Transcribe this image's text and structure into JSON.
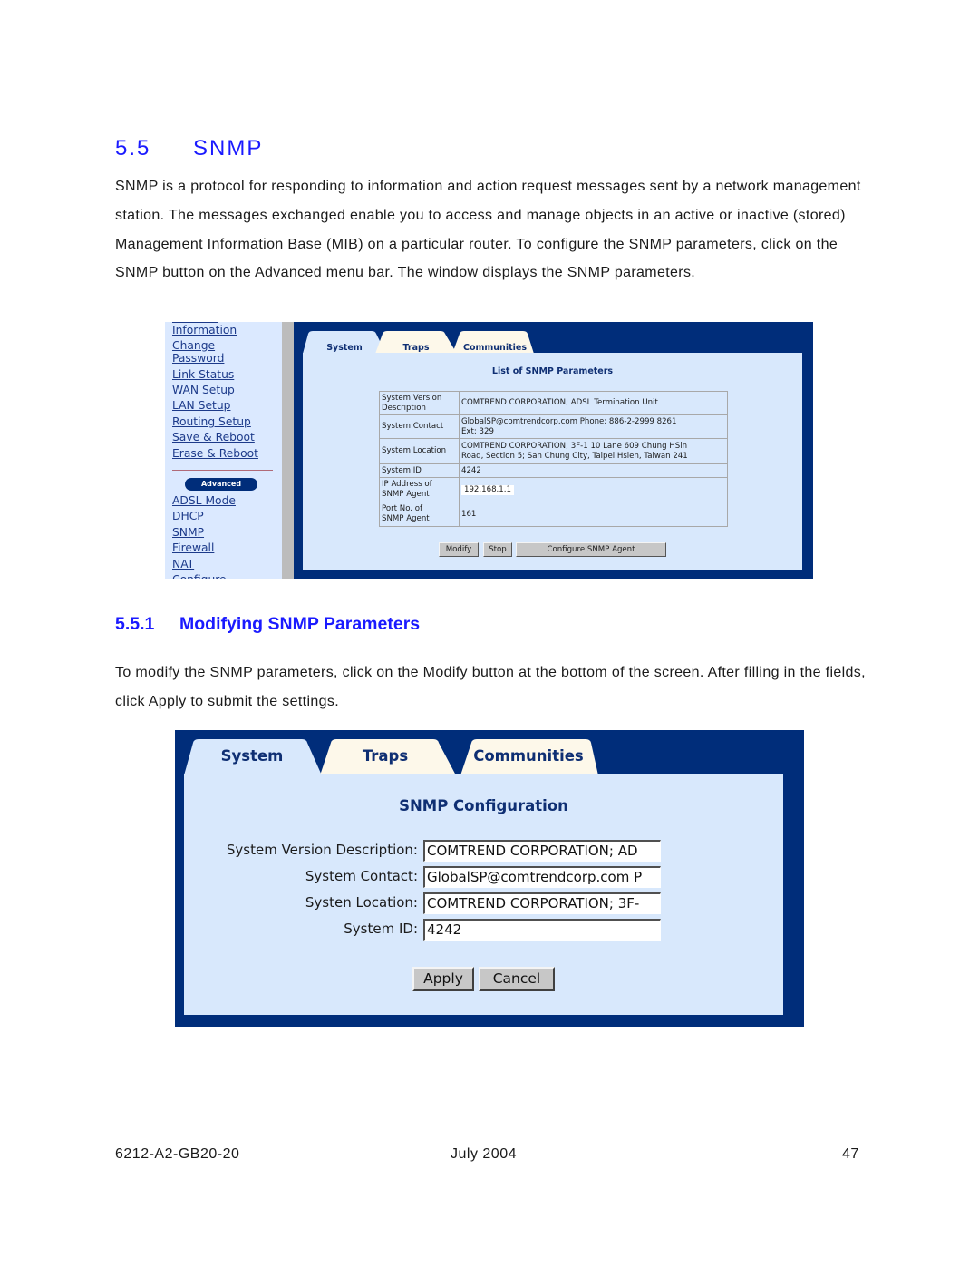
{
  "section": {
    "number": "5.5",
    "title": "SNMP",
    "intro": "SNMP is a protocol for responding to information and action request messages sent by a network management station. The messages exchanged enable you to access and manage objects in an active or inactive (stored) Management Information Base (MIB) on a particular router. To configure the SNMP parameters, click on the SNMP button on the Advanced menu bar.  The window displays the SNMP parameters."
  },
  "screenshot1": {
    "sidebar": {
      "items": [
        {
          "label": "Information"
        },
        {
          "label": "Change"
        },
        {
          "label": "Password"
        },
        {
          "label": "Link Status"
        },
        {
          "label": "WAN Setup"
        },
        {
          "label": "LAN Setup"
        },
        {
          "label": "Routing Setup"
        },
        {
          "label": "Save & Reboot"
        },
        {
          "label": "Erase & Reboot"
        }
      ],
      "advanced_label": "Advanced",
      "advanced_items": [
        {
          "label": "ADSL Mode"
        },
        {
          "label": "DHCP"
        },
        {
          "label": "SNMP"
        },
        {
          "label": "Firewall"
        },
        {
          "label": "NAT"
        },
        {
          "label": "Configure"
        }
      ]
    },
    "tabs": [
      {
        "label": "System",
        "active": true
      },
      {
        "label": "Traps",
        "active": false
      },
      {
        "label": "Communities",
        "active": false
      }
    ],
    "panel_title": "List of SNMP Parameters",
    "rows": [
      {
        "key_line1": "System Version",
        "key_line2": "Description",
        "value_line1": "COMTREND CORPORATION; ADSL Termination Unit",
        "value_line2": ""
      },
      {
        "key_line1": "System Contact",
        "key_line2": "",
        "value_line1": "GlobalSP@comtrendcorp.com Phone: 886-2-2999 8261",
        "value_line2": "Ext: 329"
      },
      {
        "key_line1": "System Location",
        "key_line2": "",
        "value_line1": "COMTREND CORPORATION; 3F-1 10 Lane 609 Chung HSin",
        "value_line2": "Road, Section 5; San Chung City, Taipei Hsien, Taiwan 241"
      },
      {
        "key_line1": "System ID",
        "key_line2": "",
        "value_line1": "4242",
        "value_line2": ""
      },
      {
        "key_line1": "IP Address of",
        "key_line2": "SNMP Agent",
        "value_line1": "192.168.1.1",
        "value_line2": ""
      },
      {
        "key_line1": "Port No. of",
        "key_line2": "SNMP Agent",
        "value_line1": "161",
        "value_line2": ""
      }
    ],
    "buttons": {
      "modify": "Modify",
      "stop": "Stop",
      "configure": "Configure SNMP Agent"
    }
  },
  "subsection": {
    "number": "5.5.1",
    "title": "Modifying SNMP Parameters",
    "text": "To modify the SNMP parameters, click on the Modify button at the bottom of the screen.  After filling in the fields, click Apply to submit the settings."
  },
  "screenshot2": {
    "tabs": [
      {
        "label": "System",
        "active": true
      },
      {
        "label": "Traps",
        "active": false
      },
      {
        "label": "Communities",
        "active": false
      }
    ],
    "panel_title": "SNMP Configuration",
    "fields": [
      {
        "label": "System Version Description:",
        "value": "COMTREND CORPORATION; AD"
      },
      {
        "label": "System Contact:",
        "value": "GlobalSP@comtrendcorp.com P"
      },
      {
        "label": "Systen Location:",
        "value": "COMTREND CORPORATION; 3F-"
      },
      {
        "label": "System ID:",
        "value": "4242"
      }
    ],
    "buttons": {
      "apply": "Apply",
      "cancel": "Cancel"
    }
  },
  "footer": {
    "doc_id": "6212-A2-GB20-20",
    "date": "July 2004",
    "page": "47"
  },
  "colors": {
    "heading_blue": "#1a1aff",
    "frame_navy": "#002d7a",
    "panel_light_blue": "#d8e8fc",
    "tab_inactive": "#fdf8ea",
    "link_blue": "#1c3a8a"
  }
}
